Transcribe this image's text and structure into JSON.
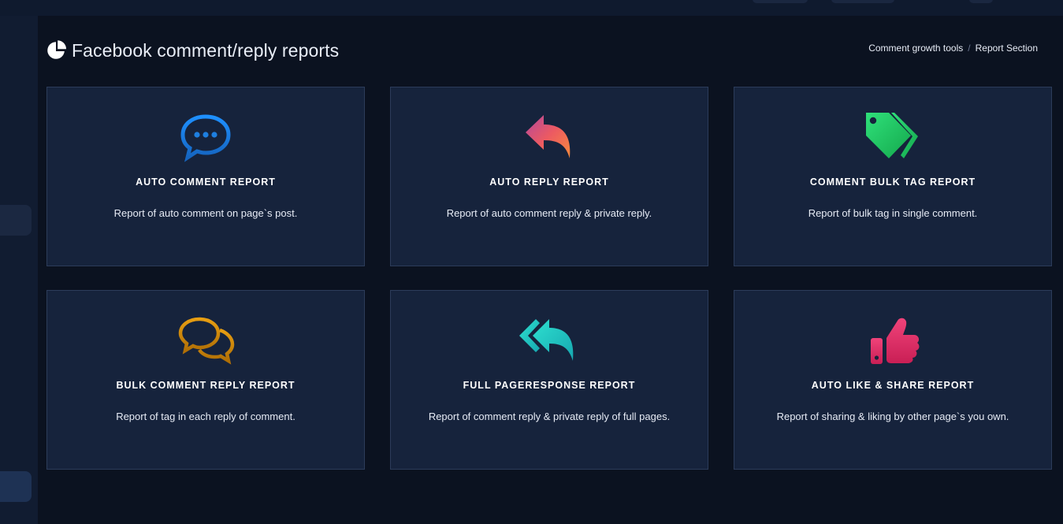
{
  "header": {
    "title": "Facebook comment/reply reports",
    "title_icon": "pie-chart-icon"
  },
  "breadcrumb": {
    "items": [
      "Comment growth tools",
      "Report Section"
    ],
    "separator": "/"
  },
  "cards": [
    {
      "title": "AUTO COMMENT REPORT",
      "description": "Report of auto comment on page`s post.",
      "icon": "comment-dots-icon",
      "color": "#1a7fe0"
    },
    {
      "title": "AUTO REPLY REPORT",
      "description": "Report of auto comment reply & private reply.",
      "icon": "reply-icon",
      "color": "#f06a4f"
    },
    {
      "title": "COMMENT BULK TAG REPORT",
      "description": "Report of bulk tag in single comment.",
      "icon": "tags-icon",
      "color": "#22c55e"
    },
    {
      "title": "BULK COMMENT REPLY REPORT",
      "description": "Report of tag in each reply of comment.",
      "icon": "comments-icon",
      "color": "#d98b0b"
    },
    {
      "title": "FULL PAGERESPONSE REPORT",
      "description": "Report of comment reply & private reply of full pages.",
      "icon": "reply-all-icon",
      "color": "#22c7c0"
    },
    {
      "title": "AUTO LIKE & SHARE REPORT",
      "description": "Report of sharing & liking by other page`s you own.",
      "icon": "thumbs-up-icon",
      "color": "#e0336b"
    }
  ]
}
